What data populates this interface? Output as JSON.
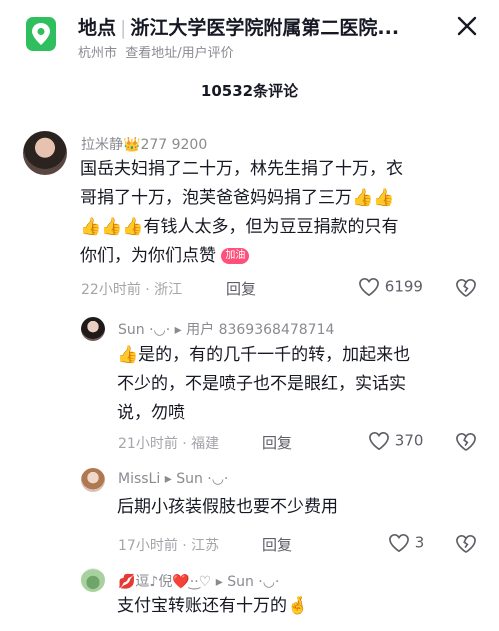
{
  "header": {
    "location_label": "地点",
    "place_name": "浙江大学医学院附属第二医院...",
    "city": "杭州市",
    "sub_links": "查看地址/用户评价",
    "close_icon": "close-icon",
    "location_icon": "map-pin-icon"
  },
  "comment_count": "10532条评论",
  "comments": [
    {
      "username": "拉米静",
      "crown": "👑",
      "user_suffix": "277 9200",
      "lines": [
        "国岳夫妇捐了二十万，林先生捐了十万，衣",
        "哥捐了十万，泡芙爸爸妈妈捐了三万👍👍",
        "👍👍👍有钱人太多，但为豆豆捐款的只有",
        "你们，为你们点赞"
      ],
      "badge": "加油",
      "time_place": "22小时前 · 浙江",
      "reply": "回复",
      "likes": "6199"
    },
    {
      "username": "Sun ·◡·",
      "arrow": "▸",
      "reply_to": "用户 8369368478714",
      "lines": [
        "👍是的，有的几千一千的转，加起来也",
        "不少的，不是喷子也不是眼红，实话实",
        "说，勿喷"
      ],
      "time_place": "21小时前 · 福建",
      "reply": "回复",
      "likes": "370"
    },
    {
      "username": "MissLi",
      "arrow": "▸",
      "reply_to": "Sun ·◡·",
      "lines": [
        "后期小孩装假肢也要不少费用"
      ],
      "time_place": "17小时前 · 江苏",
      "reply": "回复",
      "likes": "3"
    },
    {
      "username": "💋逗♪倪❤️·͜·♡",
      "arrow": "▸",
      "reply_to": "Sun ·◡·",
      "lines": [
        "支付宝转账还有十万的🤞"
      ]
    }
  ]
}
